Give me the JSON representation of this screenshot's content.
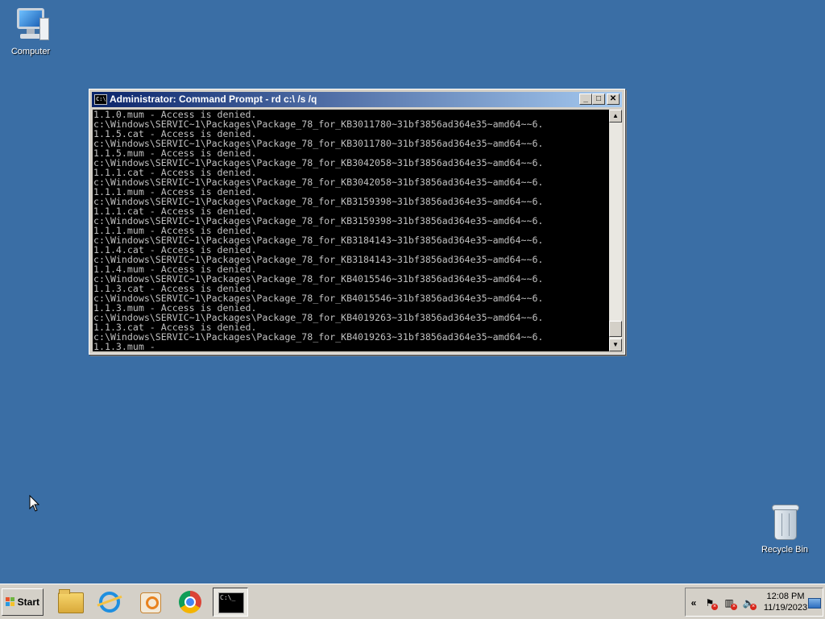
{
  "desktop": {
    "background_color": "#3a6ea5",
    "icons": {
      "computer": {
        "label": "Computer",
        "icon": "computer-icon"
      },
      "recycle_bin": {
        "label": "Recycle Bin",
        "icon": "recycle-bin-icon"
      }
    }
  },
  "window": {
    "title": "Administrator: Command Prompt - rd  c:\\ /s /q",
    "icon": "command-prompt-icon",
    "buttons": {
      "minimize": "_",
      "maximize": "□",
      "close": "✕"
    }
  },
  "console": {
    "lines": [
      "1.1.0.mum - Access is denied.",
      "c:\\Windows\\SERVIC~1\\Packages\\Package_78_for_KB3011780~31bf3856ad364e35~amd64~~6.",
      "1.1.5.cat - Access is denied.",
      "c:\\Windows\\SERVIC~1\\Packages\\Package_78_for_KB3011780~31bf3856ad364e35~amd64~~6.",
      "1.1.5.mum - Access is denied.",
      "c:\\Windows\\SERVIC~1\\Packages\\Package_78_for_KB3042058~31bf3856ad364e35~amd64~~6.",
      "1.1.1.cat - Access is denied.",
      "c:\\Windows\\SERVIC~1\\Packages\\Package_78_for_KB3042058~31bf3856ad364e35~amd64~~6.",
      "1.1.1.mum - Access is denied.",
      "c:\\Windows\\SERVIC~1\\Packages\\Package_78_for_KB3159398~31bf3856ad364e35~amd64~~6.",
      "1.1.1.cat - Access is denied.",
      "c:\\Windows\\SERVIC~1\\Packages\\Package_78_for_KB3159398~31bf3856ad364e35~amd64~~6.",
      "1.1.1.mum - Access is denied.",
      "c:\\Windows\\SERVIC~1\\Packages\\Package_78_for_KB3184143~31bf3856ad364e35~amd64~~6.",
      "1.1.4.cat - Access is denied.",
      "c:\\Windows\\SERVIC~1\\Packages\\Package_78_for_KB3184143~31bf3856ad364e35~amd64~~6.",
      "1.1.4.mum - Access is denied.",
      "c:\\Windows\\SERVIC~1\\Packages\\Package_78_for_KB4015546~31bf3856ad364e35~amd64~~6.",
      "1.1.3.cat - Access is denied.",
      "c:\\Windows\\SERVIC~1\\Packages\\Package_78_for_KB4015546~31bf3856ad364e35~amd64~~6.",
      "1.1.3.mum - Access is denied.",
      "c:\\Windows\\SERVIC~1\\Packages\\Package_78_for_KB4019263~31bf3856ad364e35~amd64~~6.",
      "1.1.3.cat - Access is denied.",
      "c:\\Windows\\SERVIC~1\\Packages\\Package_78_for_KB4019263~31bf3856ad364e35~amd64~~6.",
      "1.1.3.mum -"
    ]
  },
  "taskbar": {
    "start_label": "Start",
    "pinned": [
      {
        "name": "windows-explorer",
        "icon": "folder-icon"
      },
      {
        "name": "internet-explorer",
        "icon": "internet-explorer-icon"
      },
      {
        "name": "windows-media-player",
        "icon": "media-player-icon"
      },
      {
        "name": "google-chrome",
        "icon": "chrome-icon"
      },
      {
        "name": "command-prompt",
        "icon": "command-prompt-icon",
        "active": true
      }
    ],
    "tray": {
      "chevron": "«",
      "icons": [
        "action-center-flag-icon",
        "network-icon",
        "volume-icon"
      ],
      "time": "12:08 PM",
      "date": "11/19/2023"
    },
    "cmd_glyph": "C:\\_"
  }
}
